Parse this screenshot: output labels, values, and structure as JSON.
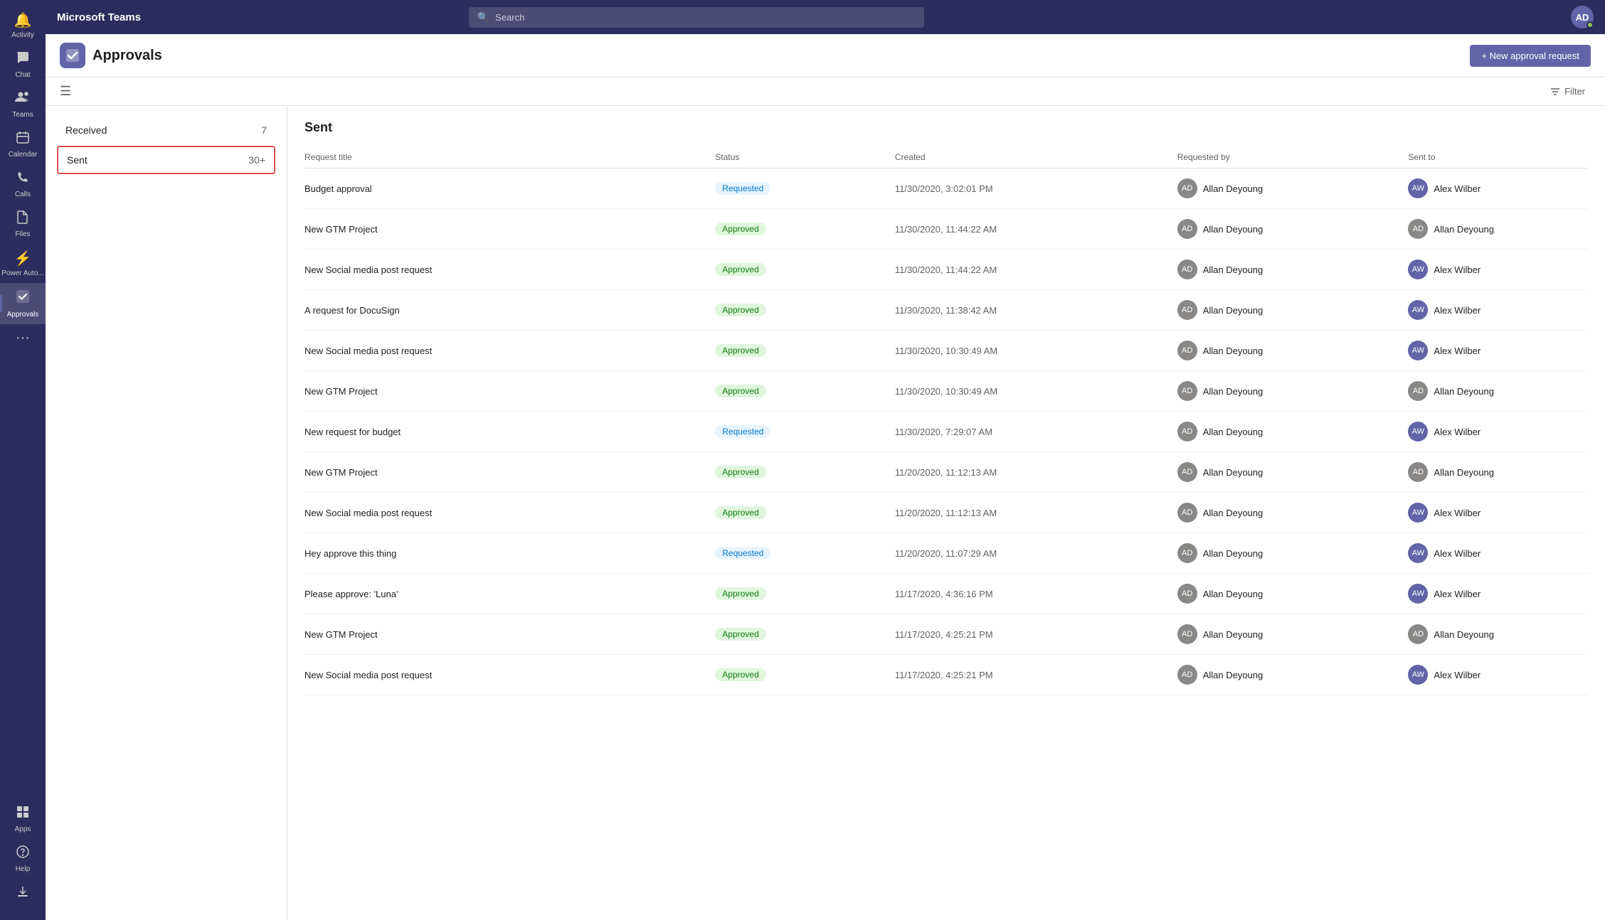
{
  "app": {
    "title": "Microsoft Teams"
  },
  "search": {
    "placeholder": "Search"
  },
  "sidebar": {
    "items": [
      {
        "id": "activity",
        "label": "Activity",
        "icon": "🔔",
        "active": false
      },
      {
        "id": "chat",
        "label": "Chat",
        "icon": "💬",
        "active": false
      },
      {
        "id": "teams",
        "label": "Teams",
        "icon": "👥",
        "active": false
      },
      {
        "id": "calendar",
        "label": "Calendar",
        "icon": "📅",
        "active": false
      },
      {
        "id": "calls",
        "label": "Calls",
        "icon": "📞",
        "active": false
      },
      {
        "id": "files",
        "label": "Files",
        "icon": "📁",
        "active": false
      },
      {
        "id": "powerauto",
        "label": "Power Auto...",
        "icon": "⚡",
        "active": false
      },
      {
        "id": "approvals",
        "label": "Approvals",
        "icon": "✓",
        "active": true
      }
    ],
    "more": "...",
    "bottom_items": [
      {
        "id": "apps",
        "label": "Apps",
        "icon": "⊞"
      },
      {
        "id": "help",
        "label": "Help",
        "icon": "?"
      },
      {
        "id": "download",
        "label": "Download",
        "icon": "↓"
      }
    ]
  },
  "page": {
    "title": "Approvals",
    "new_button": "+ New approval request",
    "filter_label": "Filter",
    "section": "Sent"
  },
  "left_nav": {
    "received": {
      "label": "Received",
      "count": "7"
    },
    "sent": {
      "label": "Sent",
      "count": "30+"
    }
  },
  "table": {
    "columns": {
      "title": "Request title",
      "status": "Status",
      "created": "Created",
      "requested_by": "Requested by",
      "sent_to": "Sent to"
    },
    "rows": [
      {
        "title": "Budget approval",
        "status": "Requested",
        "status_type": "requested",
        "created": "11/30/2020, 3:02:01 PM",
        "requested_by": "Allan Deyoung",
        "sent_to": "Alex Wilber"
      },
      {
        "title": "New GTM Project",
        "status": "Approved",
        "status_type": "approved",
        "created": "11/30/2020, 11:44:22 AM",
        "requested_by": "Allan Deyoung",
        "sent_to": "Allan Deyoung"
      },
      {
        "title": "New Social media post request",
        "status": "Approved",
        "status_type": "approved",
        "created": "11/30/2020, 11:44:22 AM",
        "requested_by": "Allan Deyoung",
        "sent_to": "Alex Wilber"
      },
      {
        "title": "A request for DocuSign",
        "status": "Approved",
        "status_type": "approved",
        "created": "11/30/2020, 11:38:42 AM",
        "requested_by": "Allan Deyoung",
        "sent_to": "Alex Wilber"
      },
      {
        "title": "New Social media post request",
        "status": "Approved",
        "status_type": "approved",
        "created": "11/30/2020, 10:30:49 AM",
        "requested_by": "Allan Deyoung",
        "sent_to": "Alex Wilber"
      },
      {
        "title": "New GTM Project",
        "status": "Approved",
        "status_type": "approved",
        "created": "11/30/2020, 10:30:49 AM",
        "requested_by": "Allan Deyoung",
        "sent_to": "Allan Deyoung"
      },
      {
        "title": "New request for budget",
        "status": "Requested",
        "status_type": "requested",
        "created": "11/30/2020, 7:29:07 AM",
        "requested_by": "Allan Deyoung",
        "sent_to": "Alex Wilber"
      },
      {
        "title": "New GTM Project",
        "status": "Approved",
        "status_type": "approved",
        "created": "11/20/2020, 11:12:13 AM",
        "requested_by": "Allan Deyoung",
        "sent_to": "Allan Deyoung"
      },
      {
        "title": "New Social media post request",
        "status": "Approved",
        "status_type": "approved",
        "created": "11/20/2020, 11:12:13 AM",
        "requested_by": "Allan Deyoung",
        "sent_to": "Alex Wilber"
      },
      {
        "title": "Hey approve this thing",
        "status": "Requested",
        "status_type": "requested",
        "created": "11/20/2020, 11:07:29 AM",
        "requested_by": "Allan Deyoung",
        "sent_to": "Alex Wilber"
      },
      {
        "title": "Please approve: 'Luna'",
        "status": "Approved",
        "status_type": "approved",
        "created": "11/17/2020, 4:36:16 PM",
        "requested_by": "Allan Deyoung",
        "sent_to": "Alex Wilber"
      },
      {
        "title": "New GTM Project",
        "status": "Approved",
        "status_type": "approved",
        "created": "11/17/2020, 4:25:21 PM",
        "requested_by": "Allan Deyoung",
        "sent_to": "Allan Deyoung"
      },
      {
        "title": "New Social media post request",
        "status": "Approved",
        "status_type": "approved",
        "created": "11/17/2020, 4:25:21 PM",
        "requested_by": "Allan Deyoung",
        "sent_to": "Alex Wilber"
      }
    ]
  },
  "colors": {
    "sidebar_bg": "#2d2c5e",
    "accent": "#6264a7",
    "approved_bg": "#dff6dd",
    "approved_text": "#107c10",
    "requested_bg": "#e8f4fd",
    "requested_text": "#0078d4"
  }
}
